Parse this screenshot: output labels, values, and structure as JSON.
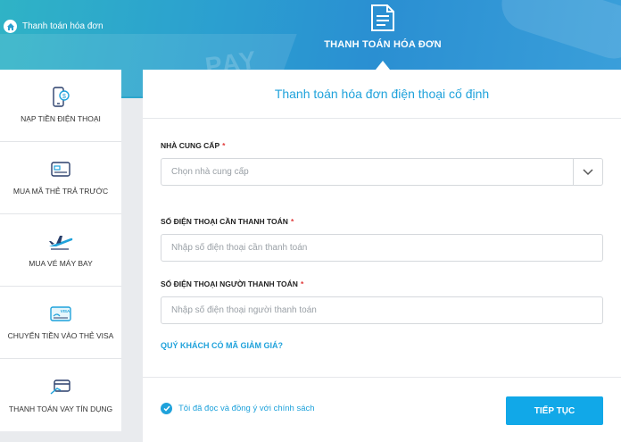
{
  "header": {
    "breadcrumb": "Thanh toán hóa đơn",
    "active_tab": "THANH TOÁN HÓA ĐƠN"
  },
  "sidebar": {
    "items": [
      {
        "label": "NẠP TIỀN ĐIỆN THOẠI",
        "icon": "phone-dollar-icon"
      },
      {
        "label": "MUA MÃ THẺ TRẢ TRƯỚC",
        "icon": "prepaid-card-icon"
      },
      {
        "label": "MUA VÉ MÁY BAY",
        "icon": "airplane-icon"
      },
      {
        "label": "CHUYỂN TIỀN VÀO THẺ VISA",
        "icon": "visa-card-icon"
      },
      {
        "label": "THANH TOÁN VAY TÍN DỤNG",
        "icon": "credit-card-icon"
      }
    ]
  },
  "form": {
    "title": "Thanh toán hóa đơn điện thoại cố định",
    "provider": {
      "label": "NHÀ CUNG CẤP",
      "required": "*",
      "placeholder": "Chọn nhà cung cấp"
    },
    "phone": {
      "label": "SỐ ĐIỆN THOẠI CẦN THANH TOÁN",
      "required": "*",
      "placeholder": "Nhập số điện thoại cần thanh toán"
    },
    "payer_phone": {
      "label": "SỐ ĐIỆN THOẠI NGƯỜI THANH TOÁN",
      "required": "*",
      "placeholder": "Nhập số điện thoại người thanh toán"
    },
    "promo_link": "QUÝ KHÁCH CÓ MÃ GIẢM GIÁ?",
    "agree_text": "Tôi đã đọc và đồng ý với chính sách",
    "submit_label": "TIẾP TỤC"
  },
  "colors": {
    "accent": "#1fa2db",
    "button": "#11a8e8",
    "required": "#e03a3a"
  }
}
